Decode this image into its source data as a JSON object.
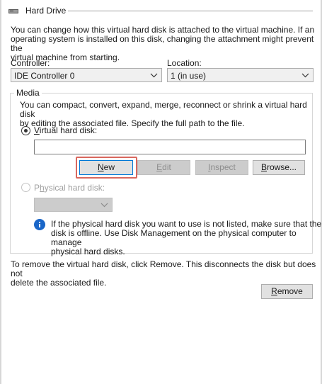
{
  "section": {
    "title": "Hard Drive",
    "icon": "hard-drive-icon"
  },
  "intro": {
    "line1": "You can change how this virtual hard disk is attached to the virtual machine. If an",
    "line2": "operating system is installed on this disk, changing the attachment might prevent the",
    "line3": "virtual machine from starting."
  },
  "controller": {
    "label": "Controller:",
    "value": "IDE Controller 0"
  },
  "location": {
    "label": "Location:",
    "value": "1 (in use)"
  },
  "media": {
    "legend": "Media",
    "desc1": "You can compact, convert, expand, merge, reconnect or shrink a virtual hard disk",
    "desc2": "by editing the associated file. Specify the full path to the file.",
    "vhd_label": "Virtual hard disk:",
    "vhd_path": "",
    "buttons": {
      "new": "New",
      "edit": "Edit",
      "inspect": "Inspect",
      "browse": "Browse..."
    },
    "physical_label": "Physical hard disk:",
    "physical_value": "",
    "info1": "If the physical hard disk you want to use is not listed, make sure that the",
    "info2": "disk is offline. Use Disk Management on the physical computer to manage",
    "info3": "physical hard disks."
  },
  "remove": {
    "text1": "To remove the virtual hard disk, click Remove. This disconnects the disk but does not",
    "text2": "delete the associated file.",
    "button": "Remove"
  },
  "colors": {
    "highlight": "#d9685f",
    "info_blue": "#1a66c8"
  }
}
